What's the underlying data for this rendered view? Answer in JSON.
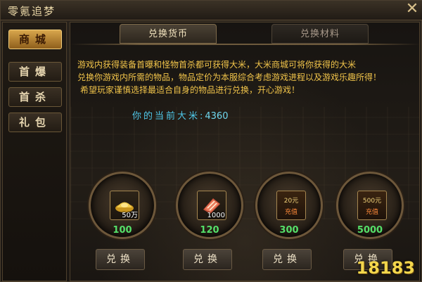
{
  "window": {
    "title": "零氪追梦",
    "close_label": "✕"
  },
  "sidebar": {
    "items": [
      {
        "label": "商城",
        "active": true
      },
      {
        "label": "首爆",
        "active": false
      },
      {
        "label": "首杀",
        "active": false
      },
      {
        "label": "礼包",
        "active": false
      }
    ]
  },
  "tabs": [
    {
      "label": "兑换货币",
      "active": true
    },
    {
      "label": "兑换材料",
      "active": false
    }
  ],
  "description": {
    "line1": "游戏内获得装备首曝和怪物首杀都可获得大米，大米商城可将你获得的大米",
    "line2": "兑换你游戏内所需的物品，物品定价为本服综合考虑游戏进程以及游戏乐趣所得！",
    "line3": "希望玩家谨慎选择最适合自身的物品进行兑换，开心游戏！"
  },
  "balance": {
    "label": "你的当前大米:",
    "value": "4360"
  },
  "items": [
    {
      "icon": "gold-ingot-icon",
      "qty": "50万",
      "price": "100",
      "button": "兑换"
    },
    {
      "icon": "meat-icon",
      "qty": "1000",
      "price": "120",
      "button": "兑换"
    },
    {
      "icon": "recharge-20-icon",
      "text1": "20元",
      "text2": "充值",
      "price": "300",
      "button": "兑换"
    },
    {
      "icon": "recharge-500-icon",
      "text1": "500元",
      "text2": "充值",
      "price": "5000",
      "button": "兑换"
    }
  ],
  "watermark": "18183"
}
